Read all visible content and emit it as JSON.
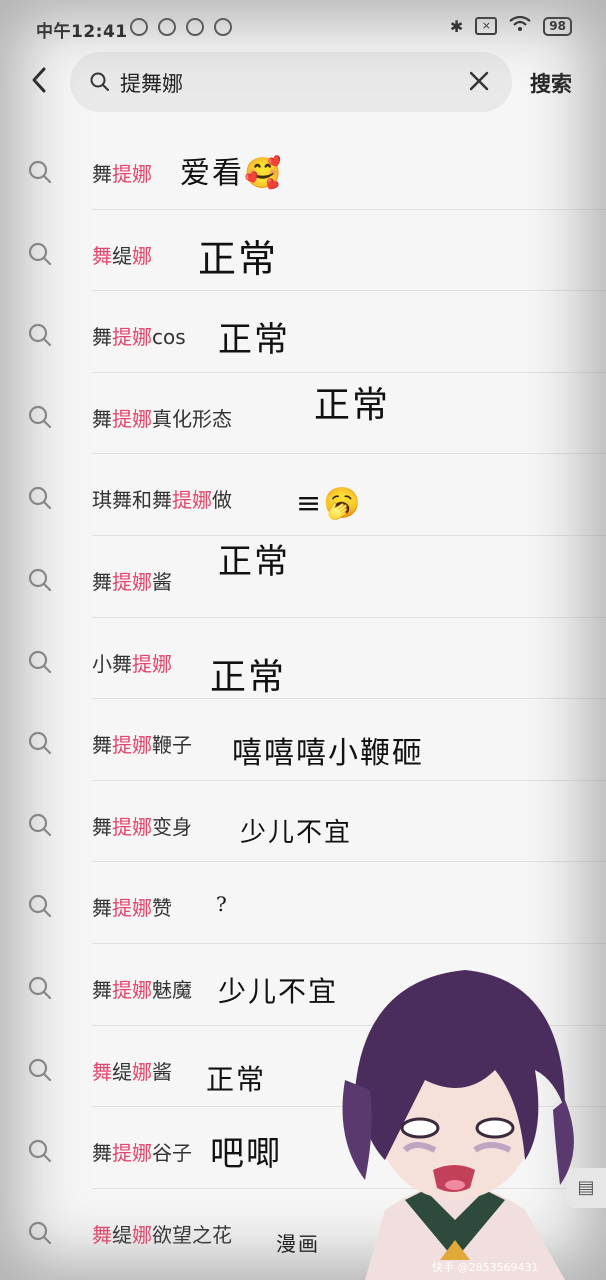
{
  "status_bar": {
    "time": "中午12:41",
    "battery": "98",
    "bluetooth_icon": "bluetooth-icon",
    "wifi_icon": "wifi-icon"
  },
  "header": {
    "back_icon": "chevron-left-icon",
    "search_query": "提舞娜",
    "clear_icon": "close-icon",
    "search_button": "搜索"
  },
  "suggestions": [
    {
      "pre": "舞",
      "hl": "提娜",
      "post": "",
      "note": "爱看🥰"
    },
    {
      "pre": "",
      "hl": "舞",
      "mid": "缇",
      "hl2": "娜",
      "post": "",
      "note": "正常"
    },
    {
      "pre": "舞",
      "hl": "提娜",
      "post": "cos",
      "note": "正常"
    },
    {
      "pre": "舞",
      "hl": "提娜",
      "post": "真化形态",
      "note": "正常"
    },
    {
      "pre": "琪舞和舞",
      "hl": "提娜",
      "post": "做",
      "note": "≡🥱"
    },
    {
      "pre": "舞",
      "hl": "提娜",
      "post": "酱",
      "note": "正常"
    },
    {
      "pre": "小舞",
      "hl": "提娜",
      "post": "",
      "note": "正常"
    },
    {
      "pre": "舞",
      "hl": "提娜",
      "post": "鞭子",
      "note": "嘻嘻嘻小鞭砸"
    },
    {
      "pre": "舞",
      "hl": "提娜",
      "post": "变身",
      "note": "少儿不宜"
    },
    {
      "pre": "舞",
      "hl": "提娜",
      "post": "赞",
      "note": "?"
    },
    {
      "pre": "舞",
      "hl": "提娜",
      "post": "魅魔",
      "note": "少儿不宜"
    },
    {
      "pre": "",
      "hl": "舞",
      "mid": "缇",
      "hl2": "娜",
      "post": "酱",
      "note": "正常"
    },
    {
      "pre": "舞",
      "hl": "提娜",
      "post": "谷子",
      "note": "吧唧"
    },
    {
      "pre": "",
      "hl": "舞",
      "mid": "缇",
      "hl2": "娜",
      "post": "欲望之花",
      "note": "漫画"
    }
  ],
  "watermark": "快手 @2853569431",
  "colors": {
    "highlight": "#e5476c",
    "background": "#f6f6f6"
  }
}
